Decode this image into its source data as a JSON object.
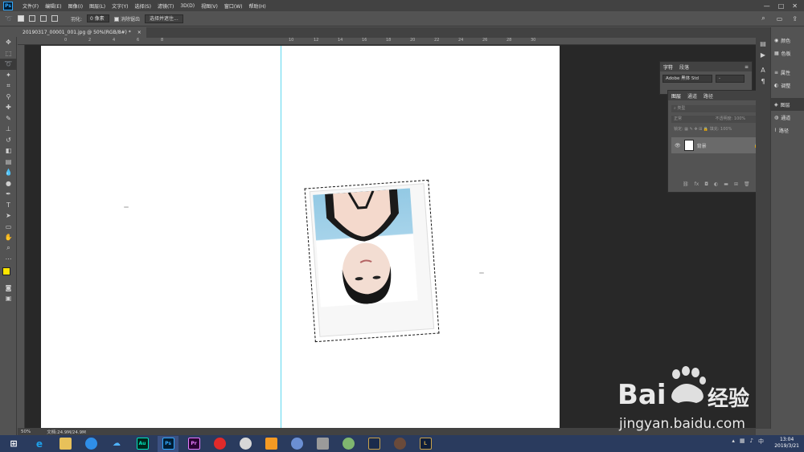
{
  "menubar": {
    "logo": "Ps",
    "items": [
      "文件(F)",
      "编辑(E)",
      "图像(I)",
      "图层(L)",
      "文字(Y)",
      "选择(S)",
      "滤镜(T)",
      "3D(D)",
      "视图(V)",
      "窗口(W)",
      "帮助(H)"
    ],
    "window_controls": [
      "—",
      "□",
      "✕"
    ]
  },
  "options": {
    "feather_label": "羽化:",
    "feather_value": "0 像素",
    "antialias_label": "消除锯齿",
    "select_mask_button": "选择并遮住..."
  },
  "document_tab": {
    "label": "20190317_00001_001.jpg @ 50%(RGB/8#) *",
    "close": "×"
  },
  "ruler_top_labels": [
    "0",
    "2",
    "4",
    "6",
    "8",
    "10",
    "12",
    "14",
    "16",
    "18",
    "20",
    "22",
    "24",
    "26",
    "28",
    "30"
  ],
  "statusbar": {
    "zoom": "50%",
    "doc_size": "文档:24.9M/24.9M"
  },
  "char_panel": {
    "tabs": [
      "字符",
      "段落"
    ],
    "font_family": "Adobe 黑体 Std",
    "font_style": "-"
  },
  "layers_panel": {
    "tabs": [
      "图层",
      "通道",
      "路径"
    ],
    "filter_label": "类型",
    "blend_mode": "正常",
    "opacity_label": "不透明度:",
    "opacity_value": "100%",
    "lock_label": "锁定:",
    "fill_label": "填充:",
    "fill_value": "100%",
    "layer_name": "背景"
  },
  "right_dock": {
    "items": [
      "颜色",
      "色板",
      "属性",
      "调整",
      "图层",
      "通道",
      "路径"
    ]
  },
  "taskbar": {
    "apps": [
      "Au",
      "Ps",
      "Pr"
    ],
    "clock_time": "13:04",
    "clock_date": "2019/3/21"
  },
  "watermark": {
    "brand": "Bai",
    "brand_cn": "经验",
    "url": "jingyan.baidu.com"
  },
  "colors": {
    "ps_blue": "#31a8ff",
    "foreground_swatch": "#ffe600",
    "guide_cyan": "#5fd8ef",
    "photo_bg_blue": "#93c9e4"
  }
}
